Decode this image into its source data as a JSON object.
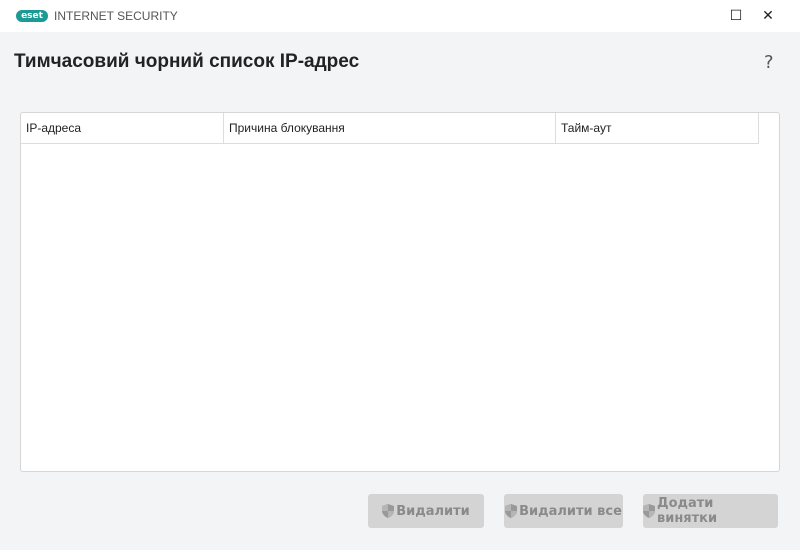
{
  "titlebar": {
    "logo": "eset",
    "product": "INTERNET SECURITY"
  },
  "page": {
    "title": "Тимчасовий чорний список IP-адрес",
    "help": "?"
  },
  "table": {
    "columns": [
      "IP-адреса",
      "Причина блокування",
      "Тайм-аут"
    ],
    "rows": []
  },
  "buttons": {
    "remove": "Видалити",
    "remove_all": "Видалити все",
    "add_exclusion": "Додати винятки"
  }
}
